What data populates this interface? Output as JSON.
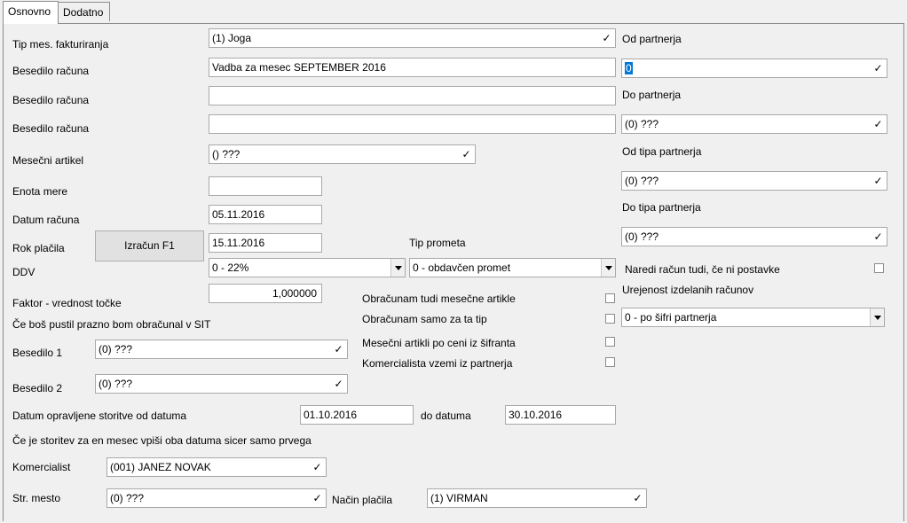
{
  "tabs": [
    {
      "label": "Osnovno"
    },
    {
      "label": "Dodatno"
    }
  ],
  "form": {
    "tip_mes_fakturiranja": {
      "label": "Tip mes. fakturiranja",
      "value": "(1) Joga"
    },
    "besedilo_racuna_1": {
      "label": "Besedilo računa",
      "value": "Vadba za mesec SEPTEMBER 2016"
    },
    "besedilo_racuna_2": {
      "label": "Besedilo računa",
      "value": ""
    },
    "besedilo_racuna_3": {
      "label": "Besedilo računa",
      "value": ""
    },
    "mesecni_artikel": {
      "label": "Mesečni artikel",
      "value": "() ???"
    },
    "enota_mere": {
      "label": "Enota mere",
      "value": ""
    },
    "datum_racuna": {
      "label": "Datum računa",
      "value": "05.11.2016"
    },
    "rok_placila": {
      "label": "Rok plačila",
      "value": "15.11.2016",
      "button": "Izračun F1"
    },
    "ddv": {
      "label": "DDV",
      "value": "0 - 22%"
    },
    "tip_prometa": {
      "label": "Tip prometa",
      "value": "0 - obdavčen promet"
    },
    "faktor": {
      "label": "Faktor - vrednost točke",
      "value": "1,000000"
    },
    "sit_note": "Če boš pustil  prazno bom obračunal v SIT",
    "besedilo_1": {
      "label": "Besedilo 1",
      "value": "(0) ???"
    },
    "besedilo_2": {
      "label": "Besedilo 2",
      "value": "(0) ???"
    },
    "datum_storitve": {
      "label": "Datum opravljene storitve od datuma",
      "from": "01.10.2016",
      "to_label": "do datuma",
      "to": "30.10.2016"
    },
    "storitev_note": "Če je storitev  za en mesec vpiši oba datuma sicer samo prvega",
    "komercialist": {
      "label": "Komercialist",
      "value": "(001) JANEZ NOVAK"
    },
    "str_mesto": {
      "label": "Str. mesto",
      "value": "(0) ???"
    },
    "nacin_placila": {
      "label": "Način plačila",
      "value": "(1) VIRMAN"
    }
  },
  "checkboxes": [
    {
      "label": "Obračunam tudi mesečne artikle",
      "checked": false
    },
    {
      "label": "Obračunam samo za ta tip",
      "checked": false
    },
    {
      "label": "Mesečni artikli po ceni iz šifranta",
      "checked": false
    },
    {
      "label": "Komercialista vzemi iz partnerja",
      "checked": false
    }
  ],
  "right": {
    "od_partnerja": {
      "label": "Od partnerja",
      "value": "0"
    },
    "do_partnerja": {
      "label": "Do partnerja",
      "value": "(0) ???"
    },
    "od_tipa_partnerja": {
      "label": "Od tipa partnerja",
      "value": "(0) ???"
    },
    "do_tipa_partnerja": {
      "label": "Do tipa partnerja",
      "value": "(0) ???"
    },
    "naredi_racun": {
      "label": "Naredi račun tudi, če ni postavke",
      "checked": false
    },
    "urejenost": {
      "label": "Urejenost  izdelanih računov",
      "value": "0 - po šifri partnerja"
    }
  },
  "icons": {
    "lookup": "✓"
  }
}
